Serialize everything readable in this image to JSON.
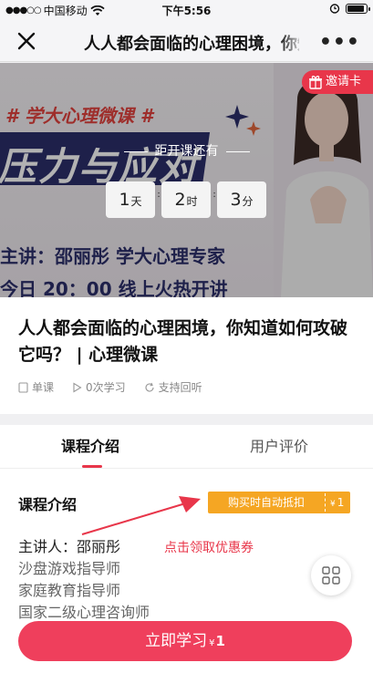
{
  "status_bar": {
    "carrier": "中国移动",
    "time": "下午5:56"
  },
  "nav": {
    "title": "人人都会面临的心理困境，你知道如何攻破它吗？ | 心理微课"
  },
  "banner": {
    "series_tag": "# 学大心理微课 #",
    "main_title": "压力与应对",
    "teacher_line": "主讲：邵丽彤  学大心理专家",
    "time_line": "今日 20：00  线上火热开讲",
    "countdown_label": "距开课还有",
    "countdown": [
      {
        "value": "1",
        "unit": "天"
      },
      {
        "value": "2",
        "unit": "时"
      },
      {
        "value": "3",
        "unit": "分"
      }
    ],
    "invite_label": "邀请卡"
  },
  "course": {
    "title": "人人都会面临的心理困境，你知道如何攻破它吗？ | 心理微课",
    "meta": {
      "type": "单课",
      "learners": "0次学习",
      "replay": "支持回听"
    }
  },
  "tabs": [
    {
      "label": "课程介绍"
    },
    {
      "label": "用户评价"
    }
  ],
  "intro": {
    "section_title": "课程介绍",
    "coupon": {
      "label": "购买时自动抵扣",
      "currency": "¥",
      "amount": "1"
    },
    "hint": "点击领取优惠券",
    "lecturer_line": "主讲人：邵丽彤",
    "lines": [
      "沙盘游戏指导师",
      "家庭教育指导师",
      "国家二级心理咨询师"
    ]
  },
  "cta": {
    "label": "立即学习",
    "currency": "¥",
    "price": "1"
  },
  "colors": {
    "accent": "#ef3f5c",
    "coupon": "#f5a623",
    "banner_navy": "#2c2f6b"
  }
}
